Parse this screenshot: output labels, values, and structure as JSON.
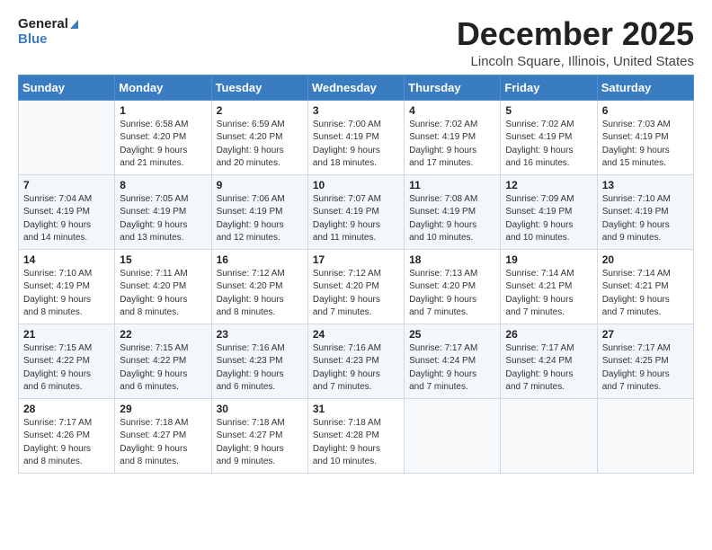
{
  "header": {
    "logo_line1": "General",
    "logo_line2": "Blue",
    "month": "December 2025",
    "location": "Lincoln Square, Illinois, United States"
  },
  "days_of_week": [
    "Sunday",
    "Monday",
    "Tuesday",
    "Wednesday",
    "Thursday",
    "Friday",
    "Saturday"
  ],
  "weeks": [
    [
      {
        "day": "",
        "info": ""
      },
      {
        "day": "1",
        "info": "Sunrise: 6:58 AM\nSunset: 4:20 PM\nDaylight: 9 hours\nand 21 minutes."
      },
      {
        "day": "2",
        "info": "Sunrise: 6:59 AM\nSunset: 4:20 PM\nDaylight: 9 hours\nand 20 minutes."
      },
      {
        "day": "3",
        "info": "Sunrise: 7:00 AM\nSunset: 4:19 PM\nDaylight: 9 hours\nand 18 minutes."
      },
      {
        "day": "4",
        "info": "Sunrise: 7:02 AM\nSunset: 4:19 PM\nDaylight: 9 hours\nand 17 minutes."
      },
      {
        "day": "5",
        "info": "Sunrise: 7:02 AM\nSunset: 4:19 PM\nDaylight: 9 hours\nand 16 minutes."
      },
      {
        "day": "6",
        "info": "Sunrise: 7:03 AM\nSunset: 4:19 PM\nDaylight: 9 hours\nand 15 minutes."
      }
    ],
    [
      {
        "day": "7",
        "info": "Sunrise: 7:04 AM\nSunset: 4:19 PM\nDaylight: 9 hours\nand 14 minutes."
      },
      {
        "day": "8",
        "info": "Sunrise: 7:05 AM\nSunset: 4:19 PM\nDaylight: 9 hours\nand 13 minutes."
      },
      {
        "day": "9",
        "info": "Sunrise: 7:06 AM\nSunset: 4:19 PM\nDaylight: 9 hours\nand 12 minutes."
      },
      {
        "day": "10",
        "info": "Sunrise: 7:07 AM\nSunset: 4:19 PM\nDaylight: 9 hours\nand 11 minutes."
      },
      {
        "day": "11",
        "info": "Sunrise: 7:08 AM\nSunset: 4:19 PM\nDaylight: 9 hours\nand 10 minutes."
      },
      {
        "day": "12",
        "info": "Sunrise: 7:09 AM\nSunset: 4:19 PM\nDaylight: 9 hours\nand 10 minutes."
      },
      {
        "day": "13",
        "info": "Sunrise: 7:10 AM\nSunset: 4:19 PM\nDaylight: 9 hours\nand 9 minutes."
      }
    ],
    [
      {
        "day": "14",
        "info": "Sunrise: 7:10 AM\nSunset: 4:19 PM\nDaylight: 9 hours\nand 8 minutes."
      },
      {
        "day": "15",
        "info": "Sunrise: 7:11 AM\nSunset: 4:20 PM\nDaylight: 9 hours\nand 8 minutes."
      },
      {
        "day": "16",
        "info": "Sunrise: 7:12 AM\nSunset: 4:20 PM\nDaylight: 9 hours\nand 8 minutes."
      },
      {
        "day": "17",
        "info": "Sunrise: 7:12 AM\nSunset: 4:20 PM\nDaylight: 9 hours\nand 7 minutes."
      },
      {
        "day": "18",
        "info": "Sunrise: 7:13 AM\nSunset: 4:20 PM\nDaylight: 9 hours\nand 7 minutes."
      },
      {
        "day": "19",
        "info": "Sunrise: 7:14 AM\nSunset: 4:21 PM\nDaylight: 9 hours\nand 7 minutes."
      },
      {
        "day": "20",
        "info": "Sunrise: 7:14 AM\nSunset: 4:21 PM\nDaylight: 9 hours\nand 7 minutes."
      }
    ],
    [
      {
        "day": "21",
        "info": "Sunrise: 7:15 AM\nSunset: 4:22 PM\nDaylight: 9 hours\nand 6 minutes."
      },
      {
        "day": "22",
        "info": "Sunrise: 7:15 AM\nSunset: 4:22 PM\nDaylight: 9 hours\nand 6 minutes."
      },
      {
        "day": "23",
        "info": "Sunrise: 7:16 AM\nSunset: 4:23 PM\nDaylight: 9 hours\nand 6 minutes."
      },
      {
        "day": "24",
        "info": "Sunrise: 7:16 AM\nSunset: 4:23 PM\nDaylight: 9 hours\nand 7 minutes."
      },
      {
        "day": "25",
        "info": "Sunrise: 7:17 AM\nSunset: 4:24 PM\nDaylight: 9 hours\nand 7 minutes."
      },
      {
        "day": "26",
        "info": "Sunrise: 7:17 AM\nSunset: 4:24 PM\nDaylight: 9 hours\nand 7 minutes."
      },
      {
        "day": "27",
        "info": "Sunrise: 7:17 AM\nSunset: 4:25 PM\nDaylight: 9 hours\nand 7 minutes."
      }
    ],
    [
      {
        "day": "28",
        "info": "Sunrise: 7:17 AM\nSunset: 4:26 PM\nDaylight: 9 hours\nand 8 minutes."
      },
      {
        "day": "29",
        "info": "Sunrise: 7:18 AM\nSunset: 4:27 PM\nDaylight: 9 hours\nand 8 minutes."
      },
      {
        "day": "30",
        "info": "Sunrise: 7:18 AM\nSunset: 4:27 PM\nDaylight: 9 hours\nand 9 minutes."
      },
      {
        "day": "31",
        "info": "Sunrise: 7:18 AM\nSunset: 4:28 PM\nDaylight: 9 hours\nand 10 minutes."
      },
      {
        "day": "",
        "info": ""
      },
      {
        "day": "",
        "info": ""
      },
      {
        "day": "",
        "info": ""
      }
    ]
  ]
}
